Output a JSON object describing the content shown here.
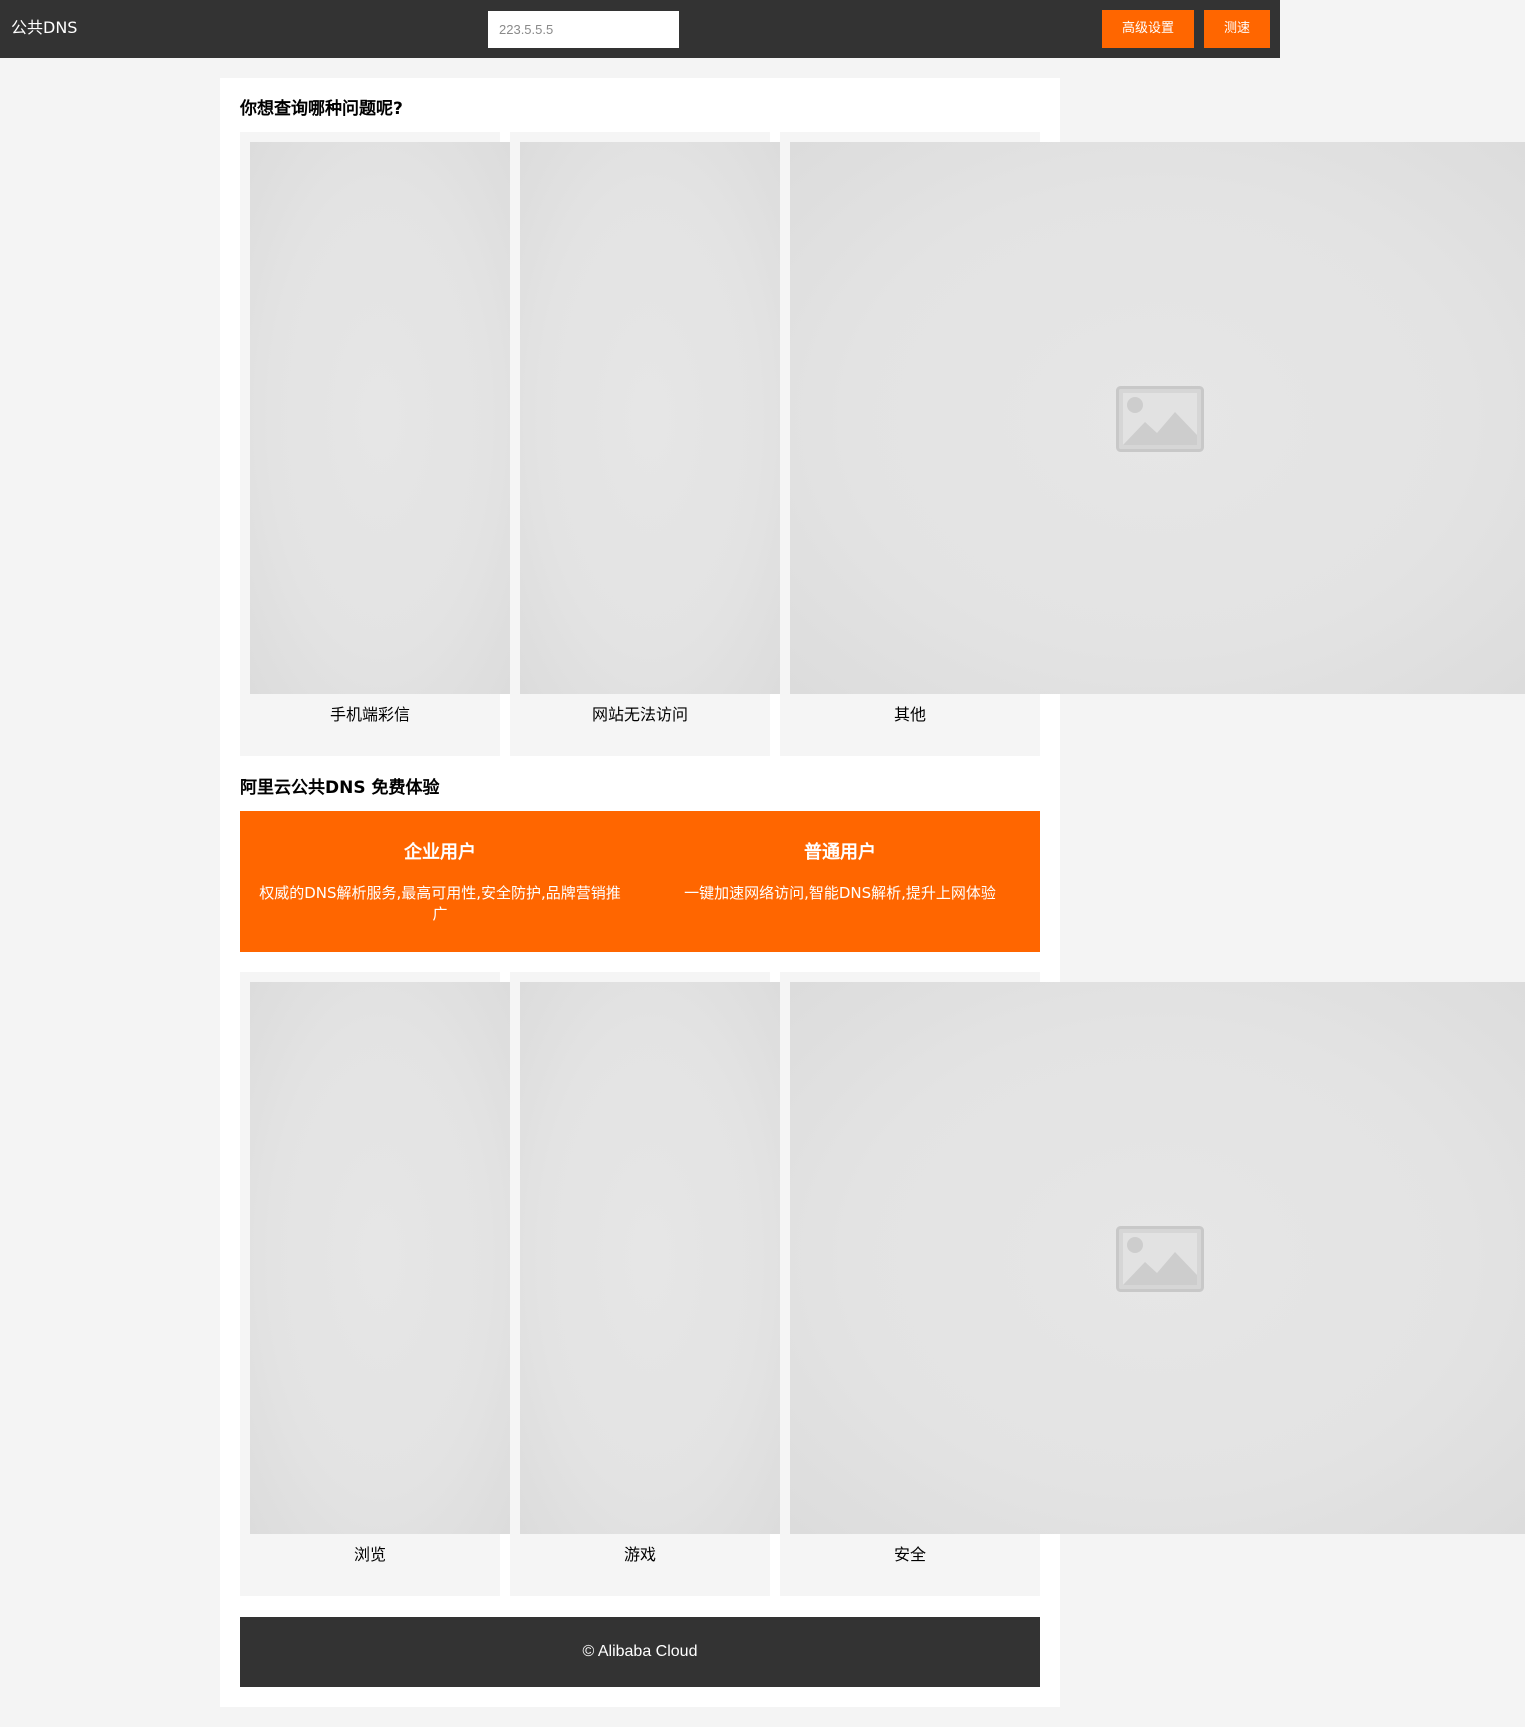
{
  "header": {
    "brand": "公共DNS",
    "search_placeholder": "223.5.5.5",
    "advanced_settings_label": "高级设置",
    "speed_test_label": "测速"
  },
  "questions": {
    "title": "你想查询哪种问题呢?",
    "items": [
      {
        "label": "手机端彩信"
      },
      {
        "label": "网站无法访问"
      },
      {
        "label": "其他"
      }
    ]
  },
  "promo": {
    "title": "阿里云公共DNS 免费体验",
    "enterprise": {
      "heading": "企业用户",
      "text": "权威的DNS解析服务,最高可用性,安全防护,品牌营销推广"
    },
    "personal": {
      "heading": "普通用户",
      "text": "一键加速网络访问,智能DNS解析,提升上网体验"
    }
  },
  "scenarios": {
    "items": [
      {
        "label": "浏览"
      },
      {
        "label": "游戏"
      },
      {
        "label": "安全"
      }
    ]
  },
  "footer": {
    "copyright": "© Alibaba Cloud"
  },
  "icons": {
    "image_placeholder": "image-placeholder-icon"
  },
  "colors": {
    "accent": "#ff6600",
    "dark": "#333333",
    "page_background": "#f4f4f4",
    "tile_background": "#f5f5f5"
  }
}
